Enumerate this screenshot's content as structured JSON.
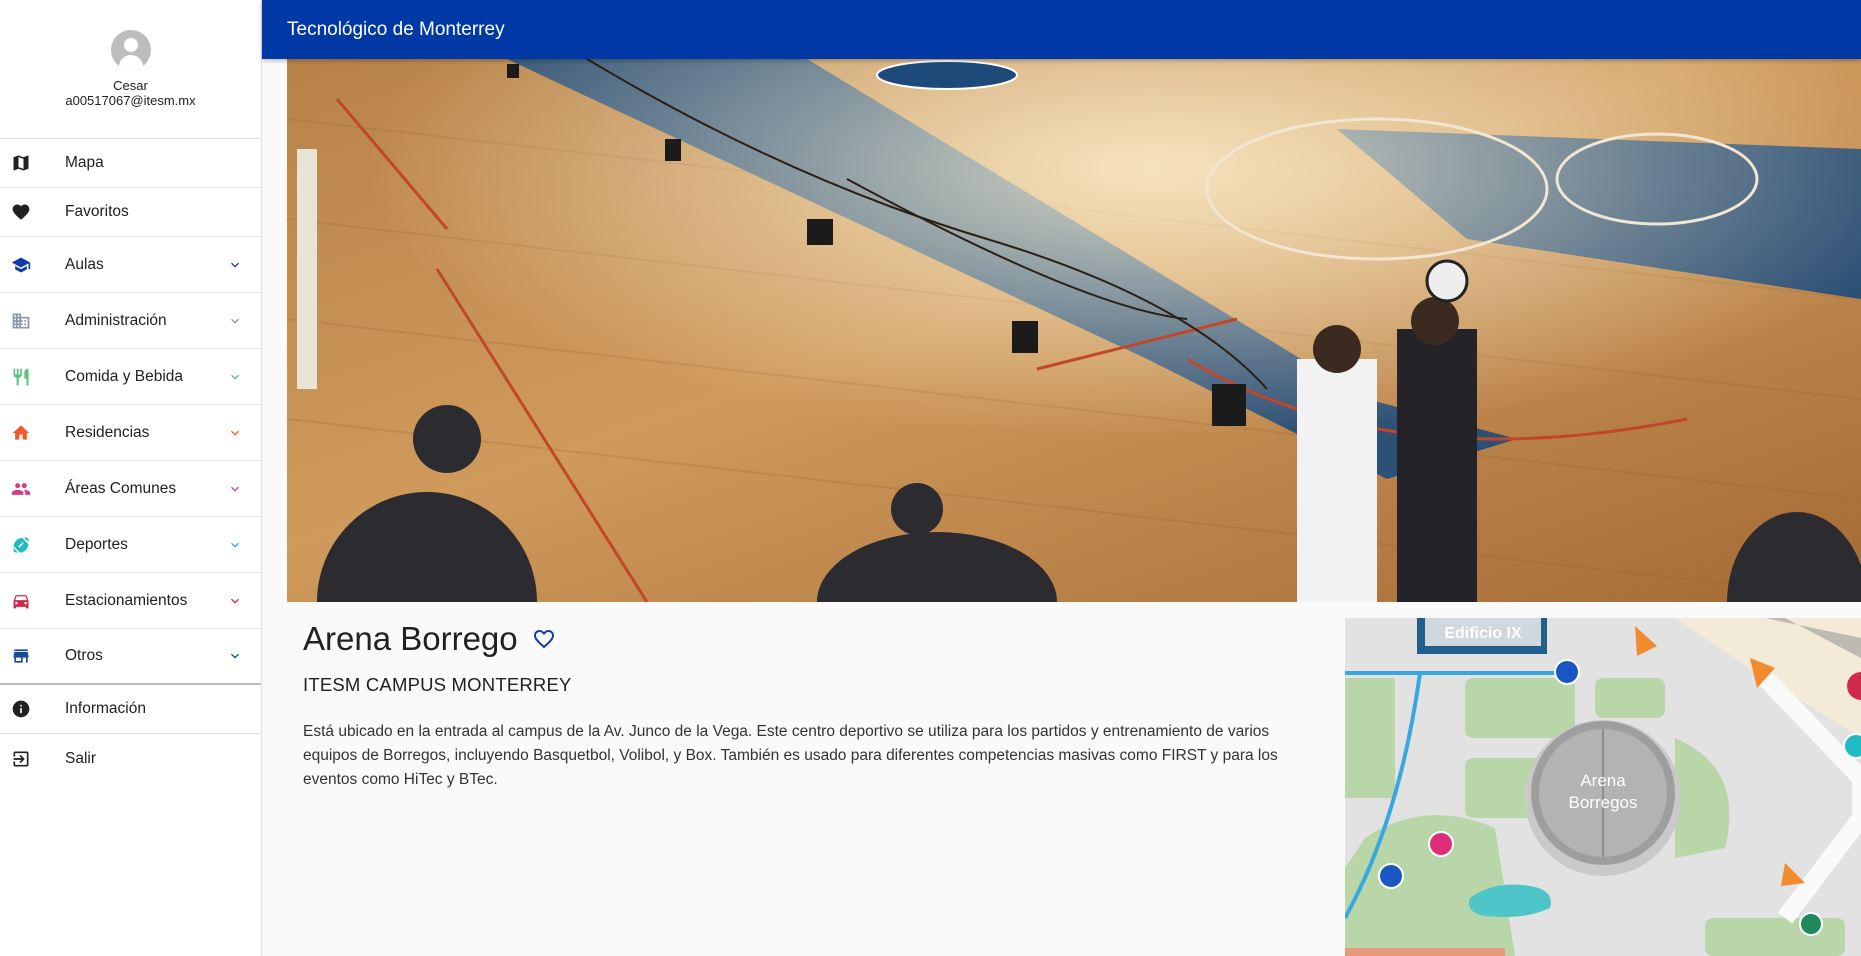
{
  "app": {
    "title": "Tecnológico de Monterrey"
  },
  "user": {
    "name": "Cesar",
    "email": "a00517067@itesm.mx"
  },
  "sidebar": {
    "items": [
      {
        "label": "Mapa",
        "icon": "map-icon",
        "color": "#212121"
      },
      {
        "label": "Favoritos",
        "icon": "heart-icon",
        "color": "#212121"
      },
      {
        "label": "Aulas",
        "icon": "school-icon",
        "color": "#0d3ea8"
      },
      {
        "label": "Administración",
        "icon": "business-icon",
        "color": "#8a96a8"
      },
      {
        "label": "Comida y Bebida",
        "icon": "restaurant-icon",
        "color": "#5cc17a"
      },
      {
        "label": "Residencias",
        "icon": "home-icon",
        "color": "#ee5a2a"
      },
      {
        "label": "Áreas Comunes",
        "icon": "people-icon",
        "color": "#d43c8d"
      },
      {
        "label": "Deportes",
        "icon": "sports-icon",
        "color": "#1fbcc3"
      },
      {
        "label": "Estacionamientos",
        "icon": "car-icon",
        "color": "#d02a4b"
      },
      {
        "label": "Otros",
        "icon": "store-icon",
        "color": "#1a4a9c"
      },
      {
        "label": "Información",
        "icon": "info-icon",
        "color": "#212121"
      },
      {
        "label": "Salir",
        "icon": "exit-icon",
        "color": "#212121"
      }
    ]
  },
  "place": {
    "name": "Arena Borrego",
    "campus": "ITESM CAMPUS MONTERREY",
    "description": "Está ubicado en la entrada al campus de la Av. Junco de la Vega. Este centro deportivo se utiliza para los partidos y entrenamiento de varios equipos de Borregos, incluyendo Basquetbol, Volibol, y Box. También es usado para diferentes competencias masivas como FIRST y para los eventos como HiTec y BTec."
  },
  "map": {
    "building_label": "Edificio IX",
    "place_label_1": "Arena",
    "place_label_2": "Borregos"
  },
  "colors": {
    "brand": "#0039a6"
  }
}
